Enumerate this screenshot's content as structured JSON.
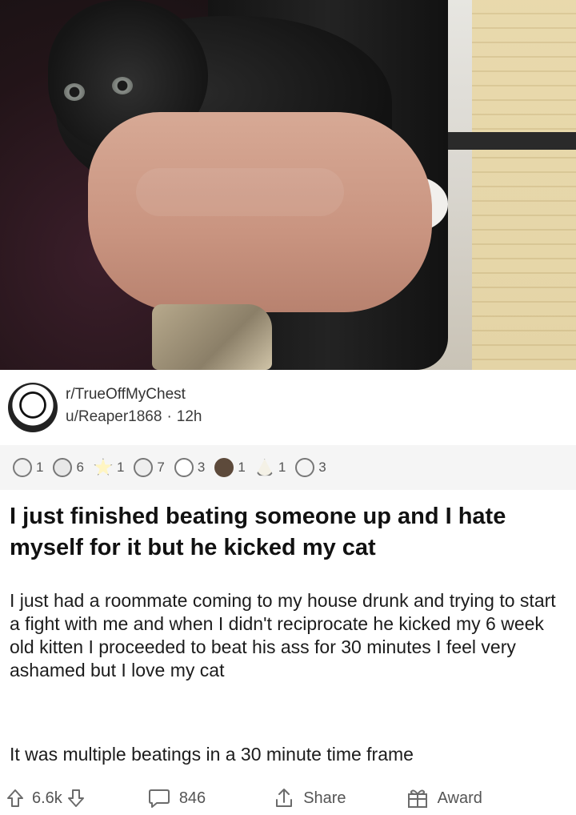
{
  "post": {
    "subreddit": "r/TrueOffMyChest",
    "username": "u/Reaper1868",
    "separator": "·",
    "time": "12h",
    "title": "I just finished beating someone up and I hate myself for it but he kicked my cat",
    "body_paragraph_1": "I just had a roommate coming to my house drunk and trying to start a fight with me and when I didn't reciprocate he kicked my 6 week old kitten I proceeded to beat his ass for 30 minutes I feel very ashamed but I love my cat",
    "body_paragraph_2": "It was multiple beatings in a 30 minute time frame"
  },
  "awards": [
    {
      "icon": "wholesome-award-icon",
      "count": "1"
    },
    {
      "icon": "silver-award-icon",
      "count": "6"
    },
    {
      "icon": "helpful-award-icon",
      "count": "1"
    },
    {
      "icon": "hug-award-icon",
      "count": "7"
    },
    {
      "icon": "face-award-icon",
      "count": "3"
    },
    {
      "icon": "bear-award-icon",
      "count": "1"
    },
    {
      "icon": "triangle-award-icon",
      "count": "1"
    },
    {
      "icon": "cheers-award-icon",
      "count": "3"
    }
  ],
  "footer": {
    "score": "6.6k",
    "comments": "846",
    "share_label": "Share",
    "award_label": "Award"
  }
}
